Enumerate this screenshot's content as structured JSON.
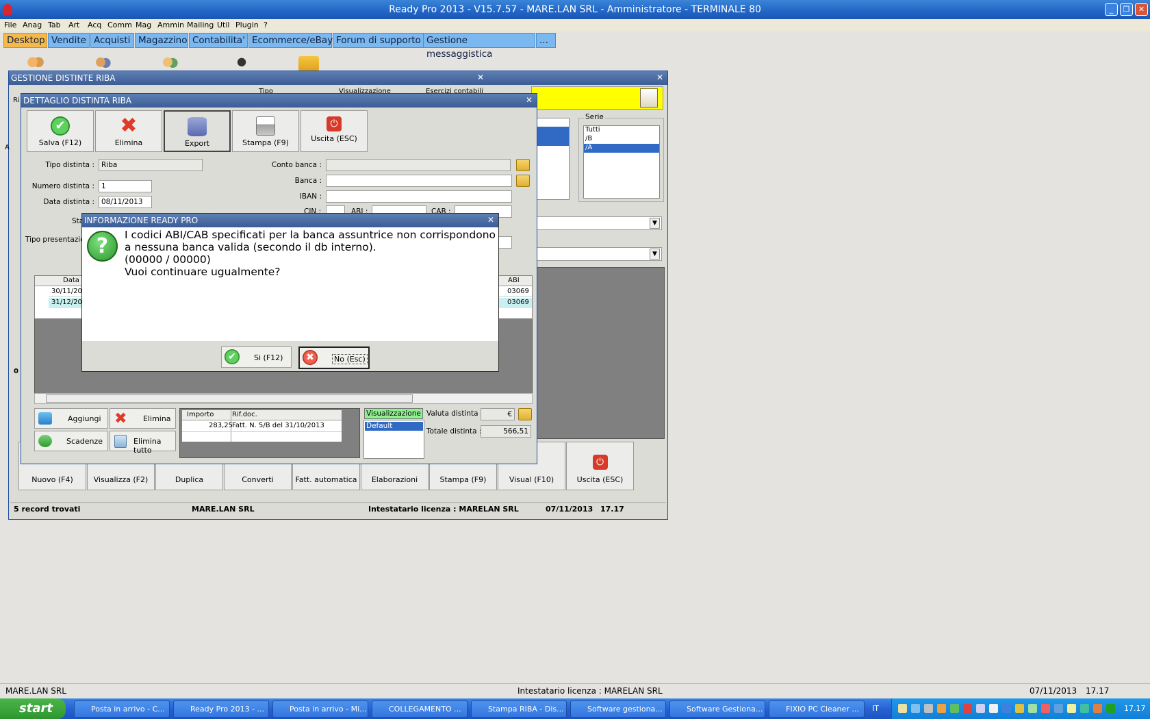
{
  "app_title": "Ready Pro 2013 - V15.7.57 - MARE.LAN SRL - Amministratore - TERMINALE 80",
  "menu": [
    "File",
    "Anag",
    "Tab",
    "Art",
    "Acq",
    "Comm",
    "Mag",
    "Ammin",
    "Mailing",
    "Util",
    "Plugin",
    "?"
  ],
  "tabs": [
    "Desktop",
    "Vendite",
    "Acquisti",
    "Magazzino",
    "Contabilita'",
    "Ecommerce/eBay",
    "Forum di supporto",
    "Gestione messaggistica",
    "..."
  ],
  "gestione": {
    "title": "GESTIONE DISTINTE RIBA",
    "header_labels": {
      "tipo": "Tipo",
      "visualizzazione": "Visualizzazione",
      "esercizi": "Esercizi contabili"
    },
    "serie_label": "Serie",
    "serie_items": [
      "Tutti",
      "/B",
      "/A"
    ],
    "serie_selected": "/A",
    "left_clip": {
      "ri": "Ri",
      "a": "A",
      "zero": "0"
    },
    "bottom_buttons": [
      "Nuovo (F4)",
      "Visualizza (F2)",
      "Duplica",
      "Converti",
      "Fatt. automatica",
      "Elaborazioni",
      "Stampa (F9)",
      "Visual (F10)",
      "Uscita (ESC)"
    ],
    "status": {
      "records": "5 record trovati",
      "company": "MARE.LAN SRL",
      "license": "Intestatario licenza : MARELAN SRL",
      "date": "07/11/2013",
      "time": "17.17"
    }
  },
  "dettaglio": {
    "title": "DETTAGLIO DISTINTA RIBA",
    "toolbar": [
      "Salva (F12)",
      "Elimina",
      "Export",
      "Stampa (F9)",
      "Uscita (ESC)"
    ],
    "labels": {
      "tipo": "Tipo distinta :",
      "numero": "Numero distinta :",
      "data": "Data distinta :",
      "stato": "Sta",
      "tipo_pres": "Tipo presentazio",
      "conto": "Conto banca :",
      "banca": "Banca :",
      "iban": "IBAN :",
      "cin": "CIN :",
      "abi": "ABI :",
      "cab": "CAB :"
    },
    "values": {
      "tipo": "Riba",
      "numero": "1",
      "data": "08/11/2013"
    },
    "grid_headers": {
      "data": "Data",
      "abi": "ABI"
    },
    "grid_rows": [
      {
        "data": "30/11/20",
        "abi": "03069"
      },
      {
        "data": "31/12/20",
        "abi": "03069"
      }
    ],
    "buttons": {
      "aggiungi": "Aggiungi",
      "elimina": "Elimina",
      "scadenze": "Scadenze",
      "elimina_tutto": "Elimina tutto"
    },
    "sub_headers": {
      "importo": "Importo",
      "rif": "Rif.doc."
    },
    "sub_row": {
      "importo": "283,25",
      "rif": "Fatt. N. 5/B del 31/10/2013"
    },
    "visual_label": "Visualizzazione",
    "visual_item": "Default",
    "valuta_label": "Valuta distinta :",
    "valuta_value": "€",
    "totale_label": "Totale distinta :",
    "totale_value": "566,51"
  },
  "dialog": {
    "title": "INFORMAZIONE READY PRO",
    "lines": [
      "I codici ABI/CAB specificati per la banca assuntrice non corrispondono",
      "a nessuna banca valida (secondo il db interno).",
      "(00000 / 00000)",
      "Vuoi continuare ugualmente?"
    ],
    "yes": "Si (F12)",
    "no": "No (Esc)"
  },
  "main_status": {
    "company": "MARE.LAN SRL",
    "license": "Intestatario licenza : MARELAN SRL",
    "date": "07/11/2013",
    "time": "17.17"
  },
  "taskbar": {
    "start": "start",
    "items": [
      "Posta in arrivo - C...",
      "Ready Pro 2013 - ...",
      "Posta in arrivo - Mi...",
      "COLLEGAMENTO ...",
      "Stampa RIBA - Dis...",
      "Software gestiona...",
      "Software Gestiona...",
      "FIXIO PC Cleaner ..."
    ],
    "lang": "IT",
    "clock": "17.17"
  },
  "colors": {
    "accent": "#2165c6",
    "tab": "#7ab8ef",
    "tab_active": "#f5b94a",
    "selection": "#316ac5",
    "visual_green": "#8ef08e",
    "yellow_panel": "#ffff00"
  }
}
